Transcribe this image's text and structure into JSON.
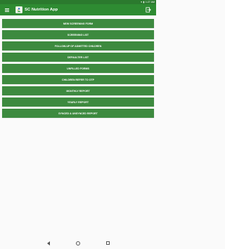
{
  "status_bar": {
    "time": "1:27 AM",
    "icons": [
      "wifi-icon",
      "battery-icon"
    ]
  },
  "app_bar": {
    "title": "SC Nutrition App",
    "menu_icon": "hamburger-menu-icon",
    "logo": "app-logo",
    "action_icon": "logout-icon"
  },
  "menu": {
    "items": [
      {
        "label": "NEW SCREENING FORM"
      },
      {
        "label": "SCREENING LIST"
      },
      {
        "label": "FOLLOW-UP OF ADMITTED CHILDREN"
      },
      {
        "label": "DEFAULTER LIST"
      },
      {
        "label": "UNFILLED FORMS"
      },
      {
        "label": "CHILDREN REFER TO OTP"
      },
      {
        "label": "MONTHLY REPORT"
      },
      {
        "label": "YEARLY REPORT"
      },
      {
        "label": "SYNCED & UNSYNCED REPORT"
      }
    ]
  },
  "nav_bar": {
    "icons": [
      "back-icon",
      "home-icon",
      "recent-apps-icon"
    ]
  },
  "colors": {
    "status_bar": "#2b7a2e",
    "app_bar": "#2e8b32",
    "button": "#3d8a3f",
    "background": "#fafafa"
  }
}
